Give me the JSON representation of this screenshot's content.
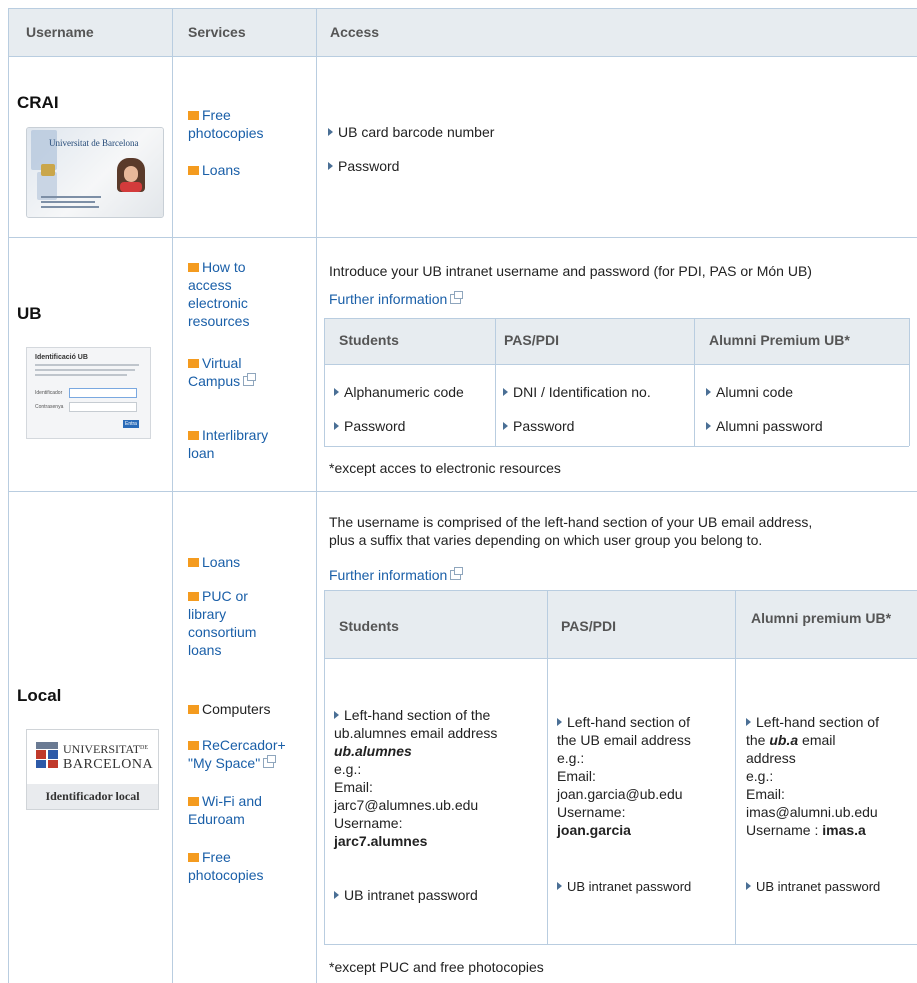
{
  "header": {
    "col_username": "Username",
    "col_services": "Services",
    "col_access": "Access"
  },
  "crai": {
    "name": "CRAI",
    "card_text": "Universitat de Barcelona",
    "services": [
      "Free photocopies",
      "Loans"
    ],
    "access": [
      "UB card barcode number",
      "Password"
    ]
  },
  "ub": {
    "name": "UB",
    "login_title": "Identificació UB",
    "login_field1": "Identificador",
    "login_field2": "Contrasenya",
    "login_button": "Entra",
    "services": [
      "How to access electronic resources",
      "Virtual Campus",
      "Interlibrary loan"
    ],
    "intro": "Introduce your UB intranet username and password (for PDI, PAS or Món UB)",
    "further": "Further information",
    "table_headers": [
      "Students",
      "PAS/PDI",
      "Alumni Premium UB*"
    ],
    "row1": [
      "Alphanumeric code",
      "DNI / Identification no.",
      "Alumni code"
    ],
    "row2": [
      "Password",
      "Password",
      "Alumni password"
    ],
    "note": "*except acces to electronic resources"
  },
  "local": {
    "name": "Local",
    "logo_line1": "UNIVERSITAT",
    "logo_de": "DE",
    "logo_line2": "BARCELONA",
    "logo_caption": "Identificador local",
    "services": [
      "Loans",
      "PUC or library consortium loans",
      "Computers",
      "ReCercador+ \"My Space\"",
      "Wi-Fi and Eduroam",
      "Free photocopies"
    ],
    "intro_line1": "The username is comprised of the left-hand section of your UB email address,",
    "intro_line2": "plus a suffix that varies depending on which user group you belong to.",
    "further": "Further information",
    "table_headers": [
      "Students",
      "PAS/PDI",
      "Alumni premium UB*"
    ],
    "students": {
      "l1": "Left-hand section of the",
      "l2": "ub.alumnes email address",
      "l3": "ub.alumnes",
      "l4": "e.g.:",
      "l5": "Email:",
      "l6": "jarc7@alumnes.ub.edu",
      "l7": "Username:",
      "l8": "jarc7.alumnes",
      "pwd": "UB intranet password"
    },
    "pas": {
      "l1": "Left-hand section of",
      "l2": "the UB email address",
      "l3": "e.g.:",
      "l4": "Email:",
      "l5": "joan.garcia@ub.edu",
      "l6": "Username:",
      "l7": "joan.garcia",
      "pwd": "UB intranet password"
    },
    "alumni": {
      "l1": "Left-hand section of",
      "l2a": "the ",
      "l2b": "ub.a",
      "l2c": " email",
      "l3": "address",
      "l4": "e.g.:",
      "l5": "Email:",
      "l6": "imas@alumni.ub.edu",
      "l7a": "Username : ",
      "l7b": "imas.a",
      "pwd": "UB intranet password"
    },
    "note": "*except PUC and free photocopies"
  }
}
